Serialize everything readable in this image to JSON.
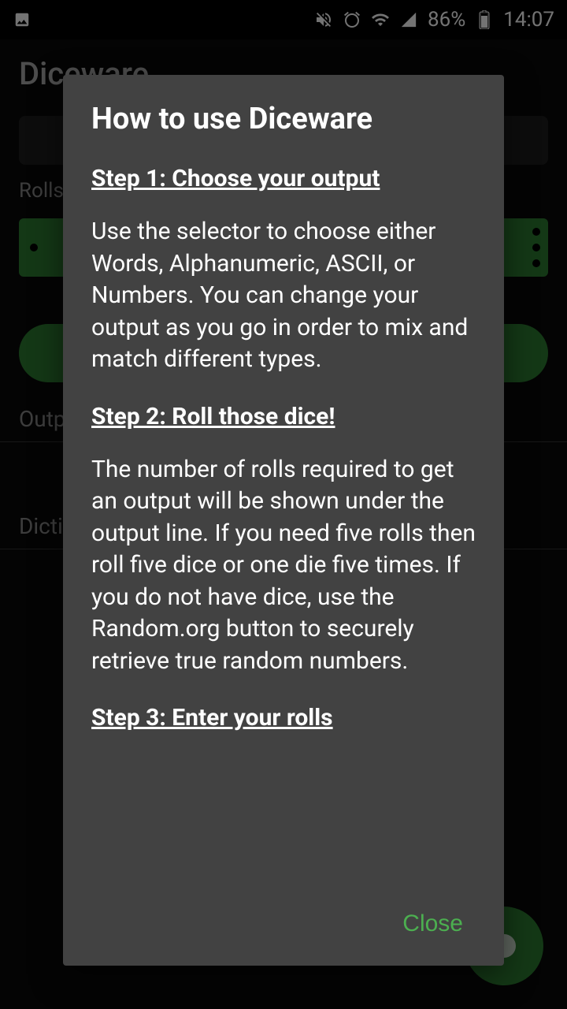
{
  "statusBar": {
    "battery": "86%",
    "time": "14:07"
  },
  "app": {
    "title": "Diceware",
    "rollsLabel": "Rolls (",
    "outputLabel": "Output",
    "dictLabel": "Dictio"
  },
  "dialog": {
    "title": "How to use Diceware",
    "step1Heading": "Step 1: Choose your output",
    "step1Text": "Use the selector to choose either Words, Alphanumeric, ASCII, or Numbers.  You can change your output as you go in order to mix and match different types.",
    "step2Heading": "Step 2: Roll those dice!",
    "step2Text": "The number of rolls required to get an output will be shown under the output line.  If you need five rolls then roll five dice or one die five times.  If you do not have dice, use the Random.org button to securely retrieve true random numbers.",
    "step3Heading": "Step 3: Enter your rolls",
    "closeLabel": "Close"
  }
}
